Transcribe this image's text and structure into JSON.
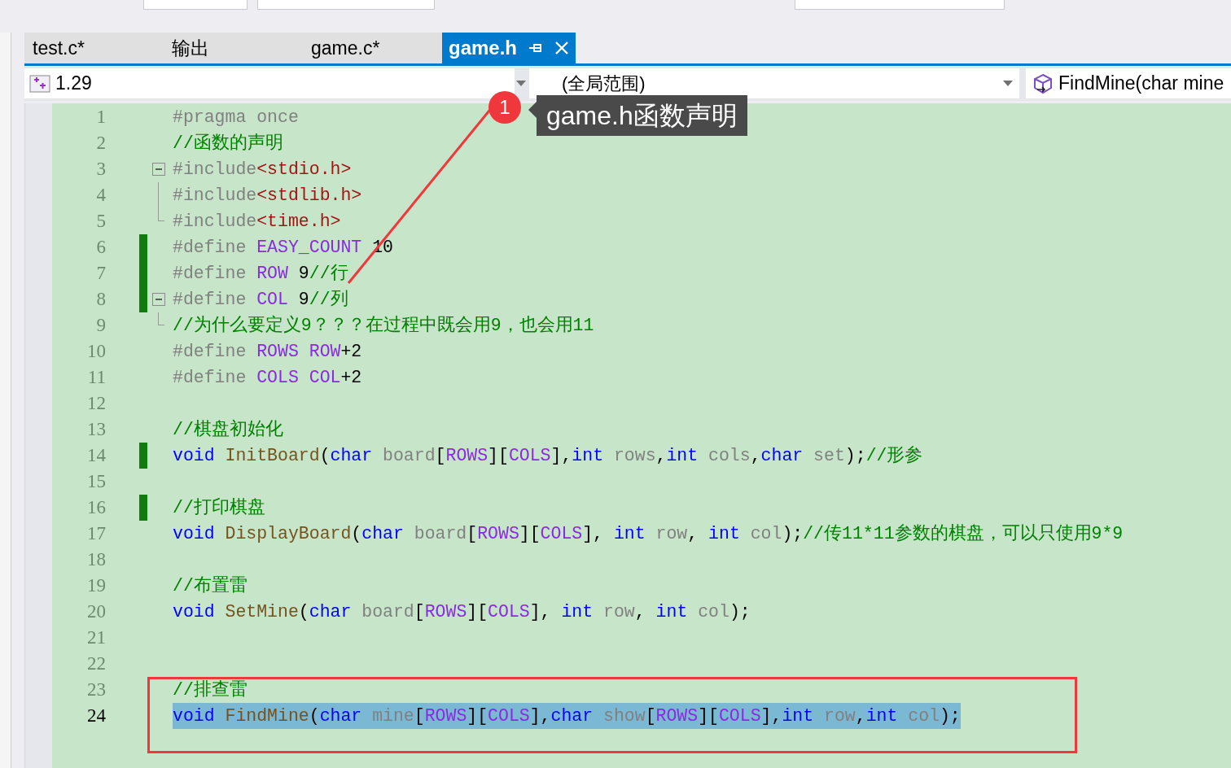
{
  "tabs": [
    {
      "label": "test.c*",
      "selected": false
    },
    {
      "label": "输出",
      "selected": false
    },
    {
      "label": "game.c*",
      "selected": false
    },
    {
      "label": "game.h",
      "selected": true
    }
  ],
  "nav_bar": {
    "project": "1.29",
    "scope": "(全局范围)",
    "member": "FindMine(char mine"
  },
  "annotation": {
    "badge": "1",
    "callout": "game.h函数声明"
  },
  "editor": {
    "lines": [
      {
        "number": "1",
        "changed": false,
        "fold_start": false,
        "in_fold": false,
        "selected": false,
        "tokens": [
          {
            "kind": "pp",
            "text": "#pragma once"
          }
        ]
      },
      {
        "number": "2",
        "changed": false,
        "fold_start": false,
        "in_fold": false,
        "selected": false,
        "tokens": [
          {
            "kind": "comment",
            "text": "//函数的声明"
          }
        ]
      },
      {
        "number": "3",
        "changed": false,
        "fold_start": true,
        "in_fold": false,
        "selected": false,
        "tokens": [
          {
            "kind": "pp",
            "text": "#include"
          },
          {
            "kind": "str",
            "text": "<stdio.h>"
          }
        ]
      },
      {
        "number": "4",
        "changed": false,
        "fold_start": false,
        "in_fold": true,
        "selected": false,
        "tokens": [
          {
            "kind": "pp",
            "text": "#include"
          },
          {
            "kind": "str",
            "text": "<stdlib.h>"
          }
        ]
      },
      {
        "number": "5",
        "changed": false,
        "fold_start": false,
        "in_fold": true,
        "selected": false,
        "tokens": [
          {
            "kind": "pp",
            "text": "#include"
          },
          {
            "kind": "str",
            "text": "<time.h>"
          }
        ]
      },
      {
        "number": "6",
        "changed": true,
        "fold_start": false,
        "in_fold": false,
        "selected": false,
        "tokens": [
          {
            "kind": "pp",
            "text": "#define "
          },
          {
            "kind": "macro",
            "text": "EASY_COUNT"
          },
          {
            "kind": "plain",
            "text": " 10"
          }
        ]
      },
      {
        "number": "7",
        "changed": true,
        "fold_start": false,
        "in_fold": false,
        "selected": false,
        "tokens": [
          {
            "kind": "pp",
            "text": "#define "
          },
          {
            "kind": "macro",
            "text": "ROW"
          },
          {
            "kind": "plain",
            "text": " 9"
          },
          {
            "kind": "comment",
            "text": "//行"
          }
        ]
      },
      {
        "number": "8",
        "changed": true,
        "fold_start": true,
        "in_fold": false,
        "selected": false,
        "tokens": [
          {
            "kind": "pp",
            "text": "#define "
          },
          {
            "kind": "macro",
            "text": "COL"
          },
          {
            "kind": "plain",
            "text": " 9"
          },
          {
            "kind": "comment",
            "text": "//列"
          }
        ]
      },
      {
        "number": "9",
        "changed": false,
        "fold_start": false,
        "in_fold": true,
        "selected": false,
        "tokens": [
          {
            "kind": "comment",
            "text": "//为什么要定义9？？？在过程中既会用9，也会用11"
          }
        ]
      },
      {
        "number": "10",
        "changed": false,
        "fold_start": false,
        "in_fold": false,
        "selected": false,
        "tokens": [
          {
            "kind": "pp",
            "text": "#define "
          },
          {
            "kind": "macro",
            "text": "ROWS ROW"
          },
          {
            "kind": "plain",
            "text": "+2"
          }
        ]
      },
      {
        "number": "11",
        "changed": false,
        "fold_start": false,
        "in_fold": false,
        "selected": false,
        "tokens": [
          {
            "kind": "pp",
            "text": "#define "
          },
          {
            "kind": "macro",
            "text": "COLS COL"
          },
          {
            "kind": "plain",
            "text": "+2"
          }
        ]
      },
      {
        "number": "12",
        "changed": false,
        "fold_start": false,
        "in_fold": false,
        "selected": false
      },
      {
        "number": "13",
        "changed": false,
        "fold_start": false,
        "in_fold": false,
        "selected": false,
        "tokens": [
          {
            "kind": "comment",
            "text": "//棋盘初始化"
          }
        ]
      },
      {
        "number": "14",
        "changed": true,
        "fold_start": false,
        "in_fold": false,
        "selected": false,
        "tokens": [
          {
            "kind": "kw",
            "text": "void "
          },
          {
            "kind": "fn",
            "text": "InitBoard"
          },
          {
            "kind": "plain",
            "text": "("
          },
          {
            "kind": "kw",
            "text": "char "
          },
          {
            "kind": "param",
            "text": "board"
          },
          {
            "kind": "plain",
            "text": "["
          },
          {
            "kind": "macro",
            "text": "ROWS"
          },
          {
            "kind": "plain",
            "text": "]["
          },
          {
            "kind": "macro",
            "text": "COLS"
          },
          {
            "kind": "plain",
            "text": "],"
          },
          {
            "kind": "kw",
            "text": "int "
          },
          {
            "kind": "param",
            "text": "rows"
          },
          {
            "kind": "plain",
            "text": ","
          },
          {
            "kind": "kw",
            "text": "int "
          },
          {
            "kind": "param",
            "text": "cols"
          },
          {
            "kind": "plain",
            "text": ","
          },
          {
            "kind": "kw",
            "text": "char "
          },
          {
            "kind": "param",
            "text": "set"
          },
          {
            "kind": "plain",
            "text": ");"
          },
          {
            "kind": "comment",
            "text": "//形参"
          }
        ]
      },
      {
        "number": "15",
        "changed": false,
        "fold_start": false,
        "in_fold": false,
        "selected": false
      },
      {
        "number": "16",
        "changed": true,
        "fold_start": false,
        "in_fold": false,
        "selected": false,
        "tokens": [
          {
            "kind": "comment",
            "text": "//打印棋盘"
          }
        ]
      },
      {
        "number": "17",
        "changed": false,
        "fold_start": false,
        "in_fold": false,
        "selected": false,
        "tokens": [
          {
            "kind": "kw",
            "text": "void "
          },
          {
            "kind": "fn",
            "text": "DisplayBoard"
          },
          {
            "kind": "plain",
            "text": "("
          },
          {
            "kind": "kw",
            "text": "char "
          },
          {
            "kind": "param",
            "text": "board"
          },
          {
            "kind": "plain",
            "text": "["
          },
          {
            "kind": "macro",
            "text": "ROWS"
          },
          {
            "kind": "plain",
            "text": "]["
          },
          {
            "kind": "macro",
            "text": "COLS"
          },
          {
            "kind": "plain",
            "text": "], "
          },
          {
            "kind": "kw",
            "text": "int "
          },
          {
            "kind": "param",
            "text": "row"
          },
          {
            "kind": "plain",
            "text": ", "
          },
          {
            "kind": "kw",
            "text": "int "
          },
          {
            "kind": "param",
            "text": "col"
          },
          {
            "kind": "plain",
            "text": ");"
          },
          {
            "kind": "comment",
            "text": "//传11*11参数的棋盘，可以只使用9*9"
          }
        ]
      },
      {
        "number": "18",
        "changed": false,
        "fold_start": false,
        "in_fold": false,
        "selected": false
      },
      {
        "number": "19",
        "changed": false,
        "fold_start": false,
        "in_fold": false,
        "selected": false,
        "tokens": [
          {
            "kind": "comment",
            "text": "//布置雷"
          }
        ]
      },
      {
        "number": "20",
        "changed": false,
        "fold_start": false,
        "in_fold": false,
        "selected": false,
        "tokens": [
          {
            "kind": "kw",
            "text": "void "
          },
          {
            "kind": "fn",
            "text": "SetMine"
          },
          {
            "kind": "plain",
            "text": "("
          },
          {
            "kind": "kw",
            "text": "char "
          },
          {
            "kind": "param",
            "text": "board"
          },
          {
            "kind": "plain",
            "text": "["
          },
          {
            "kind": "macro",
            "text": "ROWS"
          },
          {
            "kind": "plain",
            "text": "]["
          },
          {
            "kind": "macro",
            "text": "COLS"
          },
          {
            "kind": "plain",
            "text": "], "
          },
          {
            "kind": "kw",
            "text": "int "
          },
          {
            "kind": "param",
            "text": "row"
          },
          {
            "kind": "plain",
            "text": ", "
          },
          {
            "kind": "kw",
            "text": "int "
          },
          {
            "kind": "param",
            "text": "col"
          },
          {
            "kind": "plain",
            "text": ");"
          }
        ]
      },
      {
        "number": "21",
        "changed": false,
        "fold_start": false,
        "in_fold": false,
        "selected": false
      },
      {
        "number": "22",
        "changed": false,
        "fold_start": false,
        "in_fold": false,
        "selected": false
      },
      {
        "number": "23",
        "changed": false,
        "fold_start": false,
        "in_fold": false,
        "selected": false,
        "tokens": [
          {
            "kind": "comment",
            "text": "//排查雷"
          }
        ]
      },
      {
        "number": "24",
        "changed": false,
        "fold_start": false,
        "in_fold": false,
        "selected": true,
        "tokens": [
          {
            "kind": "kw",
            "text": "void "
          },
          {
            "kind": "fn",
            "text": "FindMine"
          },
          {
            "kind": "plain",
            "text": "("
          },
          {
            "kind": "kw",
            "text": "char "
          },
          {
            "kind": "param",
            "text": "mine"
          },
          {
            "kind": "plain",
            "text": "["
          },
          {
            "kind": "macro",
            "text": "ROWS"
          },
          {
            "kind": "plain",
            "text": "]["
          },
          {
            "kind": "macro",
            "text": "COLS"
          },
          {
            "kind": "plain",
            "text": "],"
          },
          {
            "kind": "kw",
            "text": "char "
          },
          {
            "kind": "param",
            "text": "show"
          },
          {
            "kind": "plain",
            "text": "["
          },
          {
            "kind": "macro",
            "text": "ROWS"
          },
          {
            "kind": "plain",
            "text": "]["
          },
          {
            "kind": "macro",
            "text": "COLS"
          },
          {
            "kind": "plain",
            "text": "],"
          },
          {
            "kind": "kw",
            "text": "int "
          },
          {
            "kind": "param",
            "text": "row"
          },
          {
            "kind": "plain",
            "text": ","
          },
          {
            "kind": "kw",
            "text": "int "
          },
          {
            "kind": "param",
            "text": "col"
          },
          {
            "kind": "plain",
            "text": ");"
          }
        ]
      }
    ]
  }
}
